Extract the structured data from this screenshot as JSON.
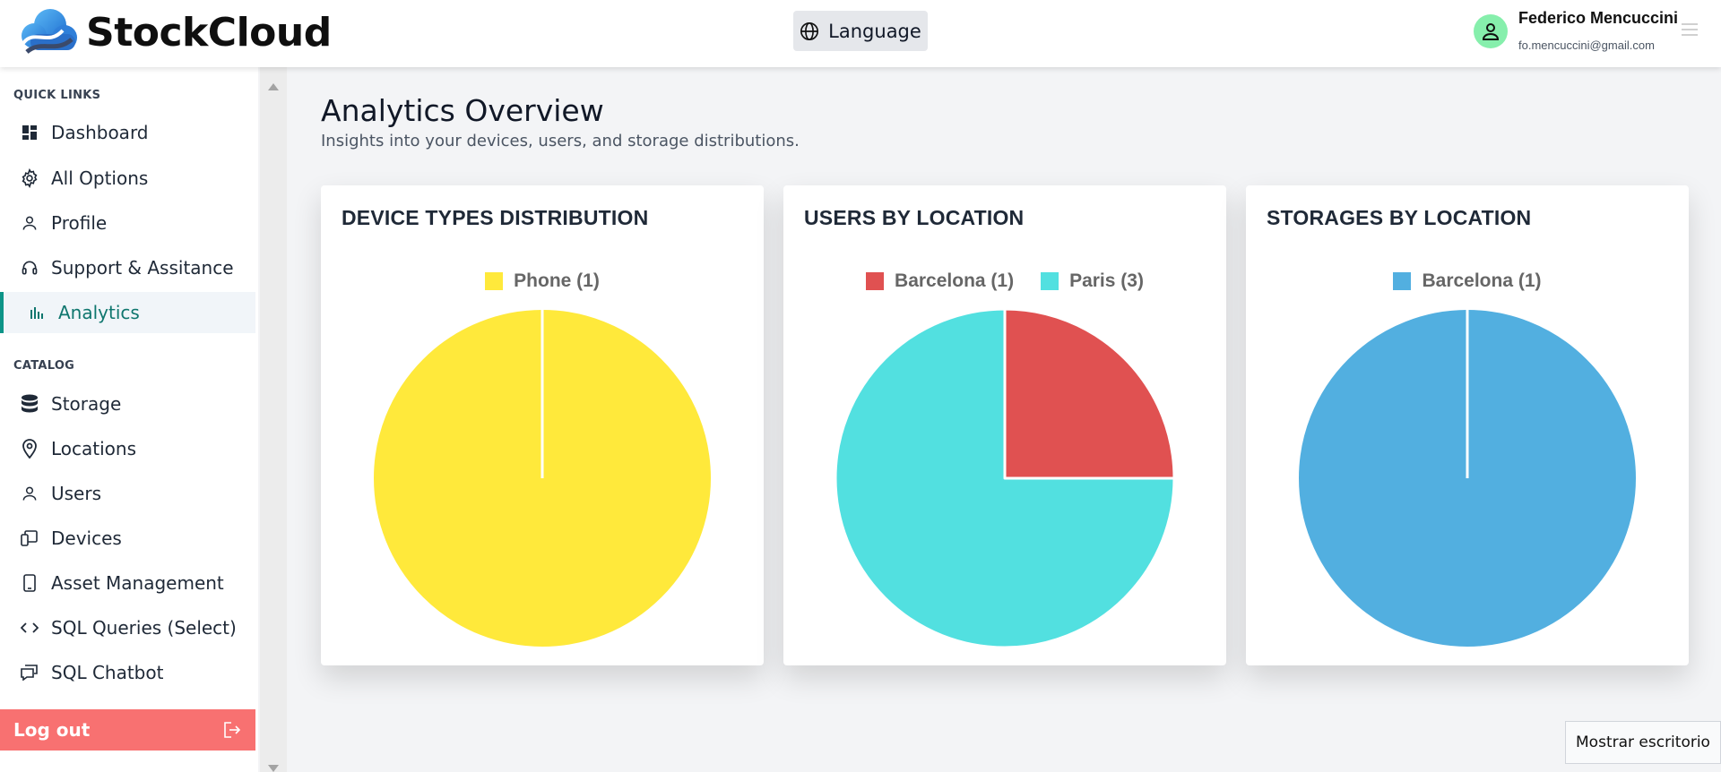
{
  "header": {
    "brand_name": "StockCloud",
    "language_label": "Language",
    "user_name": "Federico Mencuccini",
    "user_email": "fo.mencuccini@gmail.com"
  },
  "sidebar": {
    "quick_links_label": "QUICK LINKS",
    "quick_links": [
      {
        "label": "Dashboard",
        "icon": "dashboard-icon"
      },
      {
        "label": "All Options",
        "icon": "gear-icon"
      },
      {
        "label": "Profile",
        "icon": "user-icon"
      },
      {
        "label": "Support & Assitance",
        "icon": "headset-icon"
      },
      {
        "label": "Analytics",
        "icon": "bar-chart-icon",
        "active": true
      }
    ],
    "catalog_label": "CATALOG",
    "catalog": [
      {
        "label": "Storage",
        "icon": "database-icon"
      },
      {
        "label": "Locations",
        "icon": "map-pin-icon"
      },
      {
        "label": "Users",
        "icon": "user-icon"
      },
      {
        "label": "Devices",
        "icon": "devices-icon"
      },
      {
        "label": "Asset Management",
        "icon": "tablet-icon"
      },
      {
        "label": "SQL Queries (Select)",
        "icon": "code-icon"
      },
      {
        "label": "SQL Chatbot",
        "icon": "chat-icon"
      }
    ],
    "logout_label": "Log out"
  },
  "main": {
    "title": "Analytics Overview",
    "subtitle": "Insights into your devices, users, and storage distributions."
  },
  "colors": {
    "accent": "#0d9488",
    "logout": "#f87171",
    "yellow": "#ffe93b",
    "red": "#e05151",
    "cyan": "#52e0e0",
    "blue": "#52afe0"
  },
  "chart_data": [
    {
      "type": "pie",
      "title": "DEVICE TYPES DISTRIBUTION",
      "legend_position": "top",
      "categories": [
        "Phone (1)"
      ],
      "values": [
        1
      ],
      "colors": [
        "#ffe93b"
      ]
    },
    {
      "type": "pie",
      "title": "USERS BY LOCATION",
      "legend_position": "top",
      "categories": [
        "Barcelona (1)",
        "Paris (3)"
      ],
      "values": [
        1,
        3
      ],
      "colors": [
        "#e05151",
        "#52e0e0"
      ]
    },
    {
      "type": "pie",
      "title": "STORAGES BY LOCATION",
      "legend_position": "top",
      "categories": [
        "Barcelona (1)"
      ],
      "values": [
        1
      ],
      "colors": [
        "#52afe0"
      ]
    }
  ],
  "taskbar": {
    "show_desktop_label": "Mostrar escritorio"
  }
}
